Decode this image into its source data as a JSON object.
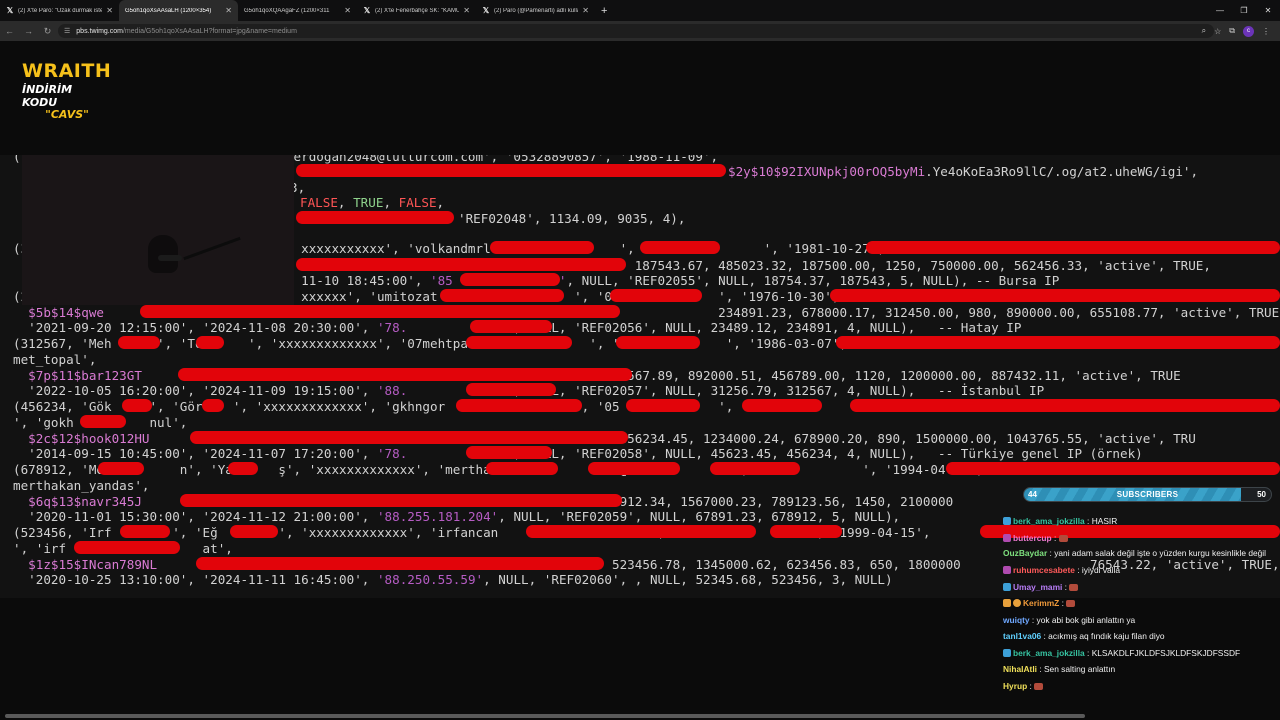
{
  "tabs": [
    {
      "title": "(2) X'te Paro: \"Uzak durmak iste",
      "active": false
    },
    {
      "title": "G5oh1qoXsAAsaLH (1200×354)",
      "active": true
    },
    {
      "title": "G5oh1qoXQAAgaFZ (1200×311",
      "active": false
    },
    {
      "title": "(2) X'te Fenerbahçe SK: \"KAMU",
      "active": false
    },
    {
      "title": "(2) Paro (@Pamenarti) adlı kulla",
      "active": false
    }
  ],
  "address": {
    "host": "pbs.twimg.com",
    "path": "/media/G5oh1qoXsAAsaLH?format=jpg&name=medium"
  },
  "logo": {
    "line1": "WRAITH",
    "line2": "İNDİRİM KODU",
    "line3": "\"CAVS\""
  },
  "terminal": {
    "l1": "('hamza', 'Erdoğan', 'xxxxx', 'hamza.erdogan2048@tutturcom.com', '05328890857', '1988-11-09',",
    "l2a": "$2y$10$92IXUNpkj00rOQ5byMi",
    "l2b": ".Ye4oKoEa3Ro9llC/.og/at2.uheWG/igi',",
    "l3": "3,",
    "l4a": "FALSE",
    "l4b": "TRUE",
    "l4c": "FALSE",
    "l5": "'REF02048', 1134.09, 9035, 4),",
    "l6": "(3                                    xxxxxxxxxxx', 'volkandmrl                 ', '054            ', '1981-10-27', ",
    "l7": "                                                                                  187543.67, 485023.32, 187500.00, 1250, 750000.00, 562456.33, 'active', TRUE,",
    "l8a": "                                      11-10 18:45:00', ",
    "l8b": "'85              '",
    "l8c": ", NULL, 'REF02055', NULL, 18754.37, 187543, 5, NULL), -- Bursa IP",
    "l9": "(2                                    xxxxxx', 'umitozat                  ', '05             ', '1976-10-30', ",
    "l10a": "  $5b$14$qwe",
    "l10b": "                                                                                 234891.23, 678000.17, 312450.00, 980, 890000.00, 655108.77, 'active', TRUE,",
    "l11a": "  '2021-09-20 12:15:00', '2024-11-08 20:30:00', ",
    "l11b": "'78.             '",
    "l11c": ", NULL, 'REF02056', NULL, 23489.12, 234891, 4, NULL),   -- Hatay IP",
    "l12": "(312567, 'Meh      ', 'To      ', 'xxxxxxxxxxxxx', '07mehtpa                ', '054           ', '1986-03-07', ",
    "l13": "met_topal',",
    "l14a": "  $7p$11$bar123GT",
    "l14b": "                                                             312567.89, 892000.51, 456789.00, 1120, 1200000.00, 887432.11, 'active', TRUE",
    "l15a": "  '2022-10-05 16:20:00', '2024-11-09 19:15:00', ",
    "l15b": "'88.             '",
    "l15c": ", NULL, 'REF02057', NULL, 31256.79, 312567, 4, NULL),   -- İstanbul IP",
    "l16": "(456234, 'Gök     ', 'Gör    ', 'xxxxxxxxxxxxx', 'gkhngor                 ', '05             ', '1                ",
    "l17": "', 'gokh          nul',",
    "l18a": "  $2c$12$hook012HU",
    "l18b": "                                                              456234.45, 1234000.24, 678900.20, 890, 1500000.00, 1043765.55, 'active', TRU",
    "l19a": "  '2014-09-15 10:45:00', '2024-11-07 17:20:00', ",
    "l19b": "'78.             '",
    "l19c": ", NULL, 'REF02058', NULL, 45623.45, 456234, 4, NULL),   -- Türkiye genel IP (örnek)",
    "l20": "(678912, 'Me          n', 'Ya      ş', 'xxxxxxxxxxxxx', 'mertha               as@              ', '05           ', '1994-04-08', ",
    "l21": "merthakan_yandas',",
    "l22a": "  $6q$13$navr345J",
    "l22b": "                                                            678912.34, 1567000.23, 789123.56, 1450, 2100000",
    "l23a": "  '2020-11-01 15:30:00', '2024-11-12 21:00:00', ",
    "l23b": "'88.255.181.204'",
    "l23c": ", NULL, 'REF02059', NULL, 67891.23, 678912, 5, NULL),",
    "l24": "(523456, 'Irf        ', 'Eğ        ', 'xxxxxxxxxxxxx', 'irfancan                    ', '054              ', '1999-04-15', ",
    "l25": "', 'irf                  at',",
    "l26a": "  $1z$15$INcan789NL",
    "l26b": "                                                            523456.78, 1345000.62, 623456.83, 650, 1800000",
    "l26c": "76543.22, 'active', TRUE,",
    "l27a": "  '2020-10-25 13:10:00', '2024-11-11 16:45:00', ",
    "l27b": "'88.250.55.59'",
    "l27c": ", NULL, 52345.68, 523456, 3, NULL)",
    "l27d": "NULL, 'REF02060'"
  },
  "subscribers": {
    "current": "44",
    "label": "SUBSCRIBERS",
    "goal": "50",
    "progress": 0.88
  },
  "chat": [
    {
      "user": "berk_ama_jokzilla",
      "text": "HASIR",
      "color": "#36c3a1",
      "badge": "#3da0d8"
    },
    {
      "user": "buttercup",
      "text": "",
      "color": "#f07ad0",
      "badge": "#b04bb0",
      "emote": true
    },
    {
      "user": "OuzBaydar",
      "text": "yani adam salak değil işte o yüzden kurgu kesinlikle değil",
      "color": "#7ee07e",
      "wrap": true
    },
    {
      "user": "ruhumcesabete",
      "text": "iyiydi valla",
      "color": "#ff5a5a",
      "badge": "#b04bb0"
    },
    {
      "user": "Umay_mami",
      "text": "",
      "color": "#b77cf5",
      "badge": "#3da0d8",
      "emote": true
    },
    {
      "user": "KerimmZ",
      "text": "",
      "color": "#f09a3a",
      "badge": "#e7a03b",
      "badge2": "#e7a03b",
      "emote": true
    },
    {
      "user": "wuiqty",
      "text": "yok abi bok gibi anlattın ya",
      "color": "#6fa8ff"
    },
    {
      "user": "tanl1va06",
      "text": "acıkmış aq fındık kaju filan diyo",
      "color": "#60d0ff"
    },
    {
      "user": "berk_ama_jokzilla",
      "text": "KLSAKDLFJKLDFSJKLDFSKJDFSSDF",
      "color": "#36c3a1",
      "badge": "#3da0d8"
    },
    {
      "user": "NihalAtli",
      "text": "Sen salting anlattın",
      "color": "#f0e05a"
    },
    {
      "user": "Hyrup",
      "text": "",
      "color": "#f0e05a",
      "emote": true
    }
  ]
}
